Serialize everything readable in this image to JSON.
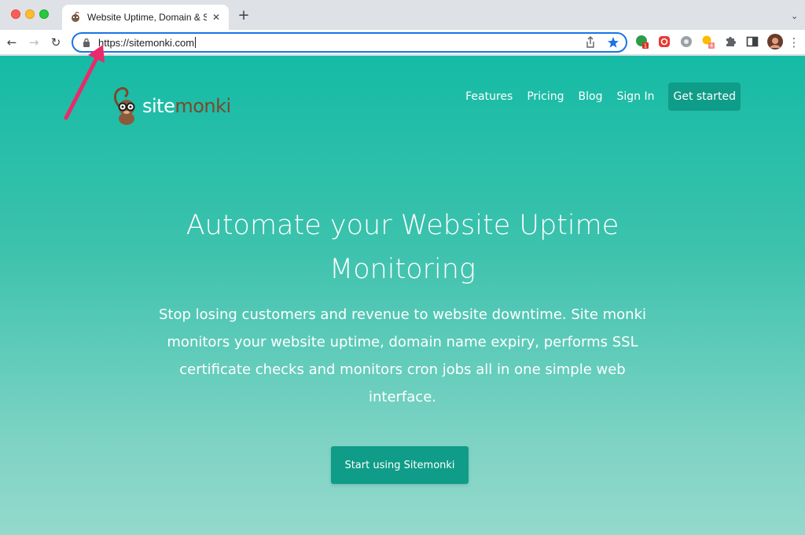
{
  "browser": {
    "tab": {
      "title": "Website Uptime, Domain & SSL",
      "favicon": "monkey-favicon-icon"
    },
    "new_tab": "+",
    "close": "✕",
    "url": "https://sitemonki.com",
    "accent": "#1a73e8",
    "extensions": [
      "ext-green-icon",
      "ext-red-icon",
      "ext-gray-gear-icon",
      "ext-bulb-icon",
      "puzzle-icon",
      "sidebar-icon",
      "avatar"
    ],
    "badges": {
      "green": "1",
      "bulb": "4"
    }
  },
  "site": {
    "logo": {
      "part1": "site",
      "part2": "monki"
    },
    "nav": {
      "features": "Features",
      "pricing": "Pricing",
      "blog": "Blog",
      "signin": "Sign In",
      "get_started": "Get started"
    },
    "hero": {
      "title_line1": "Automate your Website Uptime",
      "title_line2": "Monitoring",
      "subtitle": "Stop losing customers and revenue to website downtime. Site monki monitors your website uptime, domain name expiry, performs SSL certificate checks and monitors cron jobs all in one simple web interface.",
      "button": "Start using Sitemonki"
    },
    "colors": {
      "primary": "#15bba5",
      "button": "#0f9c88",
      "logo_brown": "#7a4a2a"
    }
  }
}
